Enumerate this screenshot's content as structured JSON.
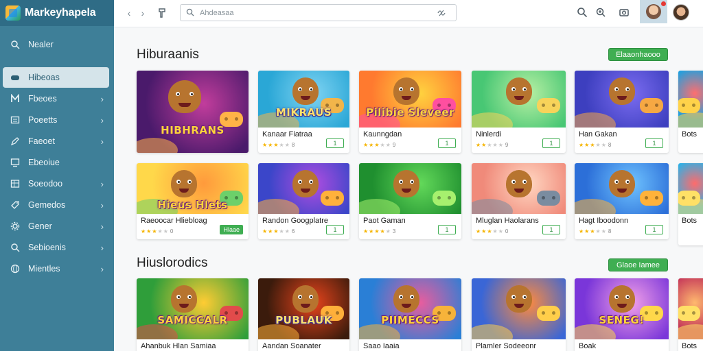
{
  "brand": {
    "name": "Markeyhapela"
  },
  "sidebar": {
    "items": [
      {
        "label": "Nealer",
        "icon": "search-icon",
        "chevron": false,
        "active": false
      },
      {
        "label": "Hibeoas",
        "icon": "gamepad-icon",
        "chevron": false,
        "active": true
      },
      {
        "label": "Fbeoes",
        "icon": "grid-icon",
        "chevron": true,
        "active": false
      },
      {
        "label": "Poeetts",
        "icon": "list-icon",
        "chevron": true,
        "active": false
      },
      {
        "label": "Faeoet",
        "icon": "pen-icon",
        "chevron": true,
        "active": false
      },
      {
        "label": "Ebeoiue",
        "icon": "monitor-icon",
        "chevron": false,
        "active": false
      },
      {
        "label": "Soeodoo",
        "icon": "table-icon",
        "chevron": true,
        "active": false
      },
      {
        "label": "Gemedos",
        "icon": "tag-icon",
        "chevron": true,
        "active": false
      },
      {
        "label": "Gener",
        "icon": "gear-icon",
        "chevron": true,
        "active": false
      },
      {
        "label": "Sebioenis",
        "icon": "search-icon",
        "chevron": true,
        "active": false
      },
      {
        "label": "Mientles",
        "icon": "globe-icon",
        "chevron": true,
        "active": false
      }
    ]
  },
  "topbar": {
    "search_placeholder": "Ahdeasaa"
  },
  "sections": [
    {
      "title": "Hiburaanis",
      "action": "Elaaonhaooo"
    },
    {
      "title": "Hiuslorodics",
      "action": "Glaoe Iamee"
    }
  ],
  "cards_row1": [
    {
      "name": "",
      "art_title": "HIBHRANS",
      "rating": 0,
      "count": "",
      "badge": "",
      "tall": true
    },
    {
      "name": "Kanaar Fiatraa",
      "art_title": "MIKRAUS",
      "rating": 3,
      "count": "8",
      "badge": "1"
    },
    {
      "name": "Kaunngdan",
      "art_title": "Pilibie Sleveer",
      "rating": 3,
      "count": "9",
      "badge": "1"
    },
    {
      "name": "Ninlerdi",
      "art_title": "",
      "rating": 2,
      "count": "9",
      "badge": "1"
    },
    {
      "name": "Han Gakan",
      "art_title": "",
      "rating": 3,
      "count": "8",
      "badge": "1"
    },
    {
      "name": "Bots",
      "art_title": "",
      "rating": 0,
      "count": "",
      "badge": ""
    }
  ],
  "cards_row2": [
    {
      "name": "Raeoocar Hliebloag",
      "art_title": "Hieus Hlets",
      "rating": 3,
      "count": "0",
      "badge": "Hlaae",
      "badge_filled": true
    },
    {
      "name": "Randon Googplatre",
      "art_title": "",
      "rating": 3,
      "count": "6",
      "badge": "1"
    },
    {
      "name": "Paot Gaman",
      "art_title": "",
      "rating": 4,
      "count": "3",
      "badge": "1"
    },
    {
      "name": "Mluglan Haolarans",
      "art_title": "",
      "rating": 3,
      "count": "0",
      "badge": "1"
    },
    {
      "name": "Hagt Iboodonn",
      "art_title": "",
      "rating": 3,
      "count": "8",
      "badge": "1"
    },
    {
      "name": "Bots",
      "art_title": "",
      "rating": 0,
      "count": "",
      "badge": ""
    }
  ],
  "cards_row3": [
    {
      "name": "Ahanbuk Hlan Samiaa",
      "art_title": "SAMICCALR"
    },
    {
      "name": "Aandan Soanater",
      "art_title": "PUBLAUK"
    },
    {
      "name": "Saao Iaaia",
      "art_title": "PIIMECCS"
    },
    {
      "name": "Plamler Sodeeonr",
      "art_title": ""
    },
    {
      "name": "Boak",
      "art_title": "SENEG!"
    },
    {
      "name": "Bots",
      "art_title": ""
    }
  ],
  "colors": {
    "sidebar": "#3e7f98",
    "accent_green": "#3fae52",
    "star": "#f5b400"
  }
}
